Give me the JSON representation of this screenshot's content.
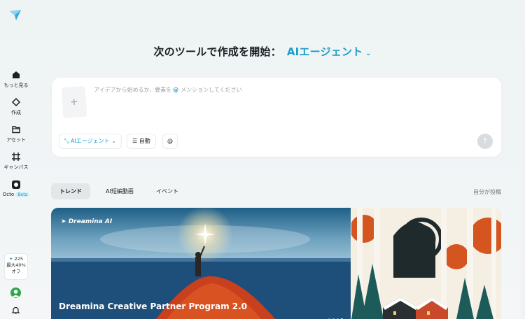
{
  "sidebar": {
    "items": [
      {
        "label": "もっと見る",
        "icon": "home-icon"
      },
      {
        "label": "作成",
        "icon": "diamond-icon"
      },
      {
        "label": "アセット",
        "icon": "folder-icon"
      },
      {
        "label": "キャンバス",
        "icon": "canvas-icon"
      },
      {
        "label": "Octo",
        "icon": "octo-icon",
        "badge": "Beta"
      }
    ],
    "credits": {
      "amount": "225",
      "promo_line1": "最大40%",
      "promo_line2": "オフ"
    }
  },
  "header": {
    "title": "次のツールで作成を開始：",
    "agent_label": "AIエージェント"
  },
  "prompt": {
    "placeholder_before": "アイデアから始めるか，要素を",
    "at_symbol": "@",
    "placeholder_after": "メンションしてください",
    "agent_chip": "AIエージェント",
    "auto_chip": "自動",
    "mention_chip": "@"
  },
  "tabs": [
    {
      "label": "トレンド",
      "active": true
    },
    {
      "label": "AI短編動画",
      "active": false
    },
    {
      "label": "イベント",
      "active": false
    }
  ],
  "self_post": "自分が投稿",
  "banner": {
    "logo": "Dreamina AI",
    "title": "Dreamina Creative Partner Program 2.0"
  },
  "colors": {
    "accent": "#1aa0c8"
  }
}
